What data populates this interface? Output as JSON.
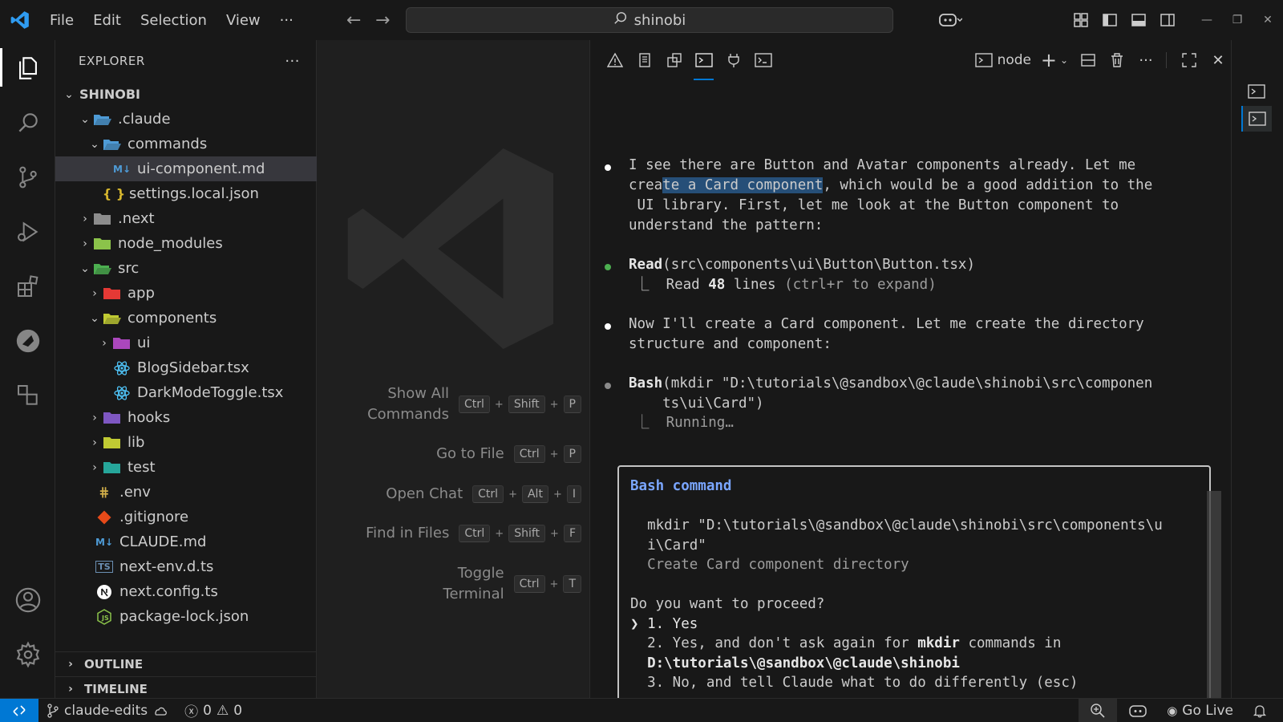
{
  "titlebar": {
    "menu": [
      "File",
      "Edit",
      "Selection",
      "View",
      "···"
    ],
    "search_text": "shinobi",
    "colors": {
      "accent": "#0078d4"
    }
  },
  "explorer": {
    "title": "EXPLORER",
    "more": "···",
    "root": "SHINOBI",
    "items": [
      {
        "label": ".claude",
        "icon": "folder-open-icon",
        "color": "#4e9bd6"
      },
      {
        "label": "commands",
        "icon": "folder-open-icon",
        "color": "#4e9bd6"
      },
      {
        "label": "ui-component.md",
        "icon": "markdown-icon",
        "color": "#4e9bd6"
      },
      {
        "label": "settings.local.json",
        "icon": "json-icon",
        "color": "#d7b72e"
      },
      {
        "label": ".next",
        "icon": "folder-icon",
        "color": "#8c8c8c"
      },
      {
        "label": "node_modules",
        "icon": "folder-icon",
        "color": "#8bc34a"
      },
      {
        "label": "src",
        "icon": "folder-open-icon",
        "color": "#4caf50"
      },
      {
        "label": "app",
        "icon": "folder-icon",
        "color": "#e53935"
      },
      {
        "label": "components",
        "icon": "folder-open-icon",
        "color": "#c0ca33"
      },
      {
        "label": "ui",
        "icon": "folder-icon",
        "color": "#ab47bc"
      },
      {
        "label": "BlogSidebar.tsx",
        "icon": "react-icon",
        "color": "#4fc3f7"
      },
      {
        "label": "DarkModeToggle.tsx",
        "icon": "react-icon",
        "color": "#4fc3f7"
      },
      {
        "label": "hooks",
        "icon": "folder-icon",
        "color": "#7e57c2"
      },
      {
        "label": "lib",
        "icon": "folder-icon",
        "color": "#c0ca33"
      },
      {
        "label": "test",
        "icon": "folder-icon",
        "color": "#26a69a"
      },
      {
        "label": ".env",
        "icon": "env-icon",
        "color": "#d4b04a"
      },
      {
        "label": ".gitignore",
        "icon": "git-icon",
        "color": "#e64a19"
      },
      {
        "label": "CLAUDE.md",
        "icon": "markdown-icon",
        "color": "#4e9bd6"
      },
      {
        "label": "next-env.d.ts",
        "icon": "typescript-icon",
        "color": "#6b8fb3"
      },
      {
        "label": "next.config.ts",
        "icon": "next-icon",
        "color": "#ffffff"
      },
      {
        "label": "package-lock.json",
        "icon": "npm-icon",
        "color": "#8bc34a"
      }
    ],
    "outline": "OUTLINE",
    "timeline": "TIMELINE"
  },
  "shortcuts": [
    {
      "label_1": "Show All",
      "label_2": "Commands",
      "keys": [
        "Ctrl",
        "Shift",
        "P"
      ]
    },
    {
      "label_1": "Go to File",
      "keys": [
        "Ctrl",
        "P"
      ]
    },
    {
      "label_1": "Open Chat",
      "keys": [
        "Ctrl",
        "Alt",
        "I"
      ]
    },
    {
      "label_1": "Find in Files",
      "keys": [
        "Ctrl",
        "Shift",
        "F"
      ]
    },
    {
      "label_1": "Toggle",
      "label_2": "Terminal",
      "keys": [
        "Ctrl",
        "T"
      ]
    }
  ],
  "panel": {
    "terminal_name": "node"
  },
  "terminal": {
    "msg1_l1": "I see there are Button and Avatar components already. Let me",
    "msg1_l2a": "crea",
    "msg1_l2b": "te a Card component",
    "msg1_l2c": ", which would be a good addition to the",
    "msg1_l3": " UI library. First, let me look at the Button component to",
    "msg1_l4": "understand the pattern:",
    "read_tool": "Read",
    "read_args": "(src\\components\\ui\\Button\\Button.tsx)",
    "read_result_pre": "⎿  Read ",
    "read_result_bold": "48",
    "read_result_mid": " lines ",
    "read_result_dim": "(ctrl+r to expand)",
    "msg2_l1": "Now I'll create a Card component. Let me create the directory",
    "msg2_l2": "structure and component:",
    "bash_tool": "Bash",
    "bash_args_l1": "(mkdir \"D:\\tutorials\\@sandbox\\@claude\\shinobi\\src\\componen",
    "bash_args_l2": "    ts\\ui\\Card\")",
    "running": "⎿  Running…",
    "box_title": "Bash command",
    "box_cmd_l1": "  mkdir \"D:\\tutorials\\@sandbox\\@claude\\shinobi\\src\\components\\u",
    "box_cmd_l2": "  i\\Card\"",
    "box_desc": "  Create Card component directory",
    "box_question": "Do you want to proceed?",
    "opt1": "❯ 1. Yes",
    "opt2_pre": "  2. Yes, and don't ask again for ",
    "opt2_bold": "mkdir",
    "opt2_post": " commands in",
    "opt2_path": "  D:\\tutorials\\@sandbox\\@claude\\shinobi",
    "opt3": "  3. No, and tell Claude what to do differently (esc)"
  },
  "statusbar": {
    "branch": "claude-edits",
    "errors": "0",
    "warnings": "0",
    "go_live": "Go Live"
  }
}
